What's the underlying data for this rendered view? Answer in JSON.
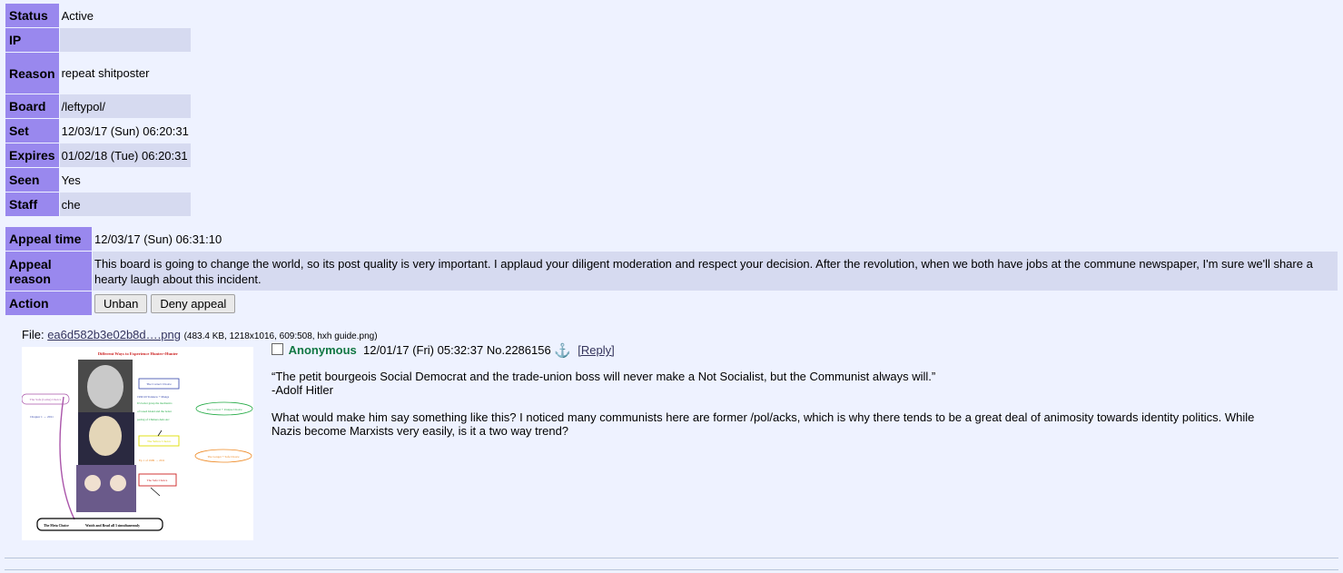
{
  "ban": {
    "status_label": "Status",
    "status_value": "Active",
    "ip_label": "IP",
    "ip_value": "",
    "reason_label": "Reason",
    "reason_value": "repeat shitposter",
    "board_label": "Board",
    "board_value": "/leftypol/",
    "set_label": "Set",
    "set_value": "12/03/17 (Sun) 06:20:31",
    "expires_label": "Expires",
    "expires_value": "01/02/18 (Tue) 06:20:31",
    "seen_label": "Seen",
    "seen_value": "Yes",
    "staff_label": "Staff",
    "staff_value": "che"
  },
  "appeal": {
    "time_label": "Appeal time",
    "time_value": "12/03/17 (Sun) 06:31:10",
    "reason_label_1": "Appeal",
    "reason_label_2": "reason",
    "reason_value": "This board is going to change the world, so its post quality is very important. I applaud your diligent moderation and respect your decision. After the revolution, when we both have jobs at the commune newspaper, I'm sure we'll share a hearty laugh about this incident.",
    "action_label": "Action",
    "unban_button": "Unban",
    "deny_button": "Deny appeal"
  },
  "file": {
    "prefix": "File:",
    "link": "ea6d582b3e02b8d….png",
    "meta": "(483.4 KB, 1218x1016, 609:508, hxh guide.png)"
  },
  "thumbnail": {
    "title": "Different Ways to Experience Hunter×Hunter",
    "safe_choice": "The Safe (Lame) Choice",
    "chapter_note": "Chapter 1 → 2011",
    "correct_choice": "The Correct Choice",
    "correct_note_1": "1999 till Yorknew + Manga",
    "correct_note_2": "It's better grasp the mechanics",
    "correct_note_3": "of Greed Island and the better",
    "correct_note_4": "pacing of Chimera Ants Arc",
    "unique_choice": "The Correct + Unique Choice",
    "yellow_choice": "The Yellow Choice",
    "range_note": "Ep 1 of 1999 → 2011",
    "longer_choice": "The Longer + Safe Choice",
    "safe_choice_2": "The Safe Choice",
    "meta_choice": "The Meta Choice",
    "meta_note": "Watch and Read all 3 simultaneously",
    "colors": {
      "title": "#cc2222",
      "correct": "#3344aa",
      "unique": "#22aa44",
      "yellow": "#dddd00",
      "longer": "#ee8822",
      "safe": "#cc2222",
      "arc": "#aa55aa"
    }
  },
  "post": {
    "name": "Anonymous",
    "date": "12/01/17 (Fri) 05:32:37",
    "number": "No.2286156",
    "anchor_icon": "⚓",
    "reply": "[Reply]",
    "line1": "“The petit bourgeois Social Democrat and the trade-union boss will never make a Not Socialist, but the Communist always will.”",
    "line2": "-Adolf Hitler",
    "para2": "What would make him say something like this? I noticed many communists here are former /pol/acks, which is why there tends to be a great deal of animosity towards identity politics. While Nazis become Marxists very easily, is it a two way trend?"
  }
}
